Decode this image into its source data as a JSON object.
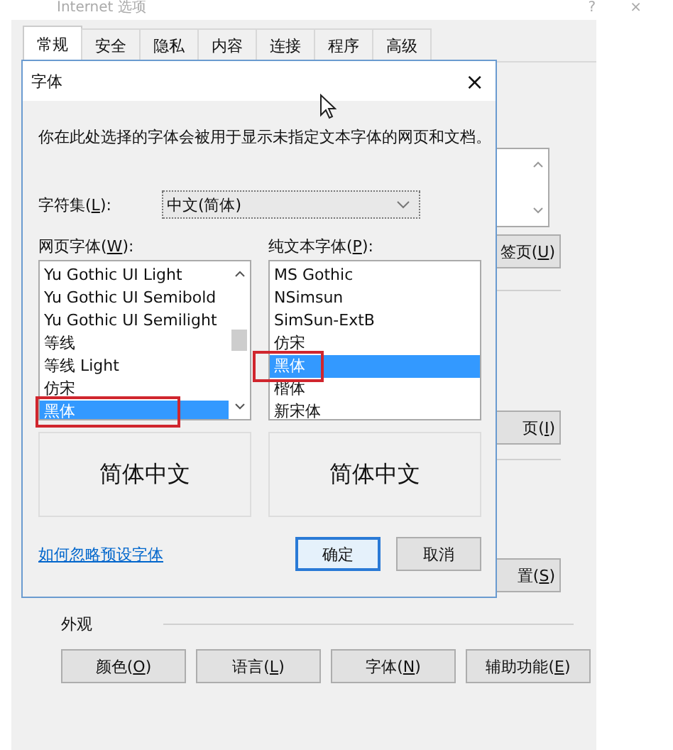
{
  "window": {
    "title": "Internet 选项",
    "help": "?",
    "close": "×"
  },
  "tabs": [
    {
      "label": "常规",
      "selected": true
    },
    {
      "label": "安全",
      "selected": false
    },
    {
      "label": "隐私",
      "selected": false
    },
    {
      "label": "内容",
      "selected": false
    },
    {
      "label": "连接",
      "selected": false
    },
    {
      "label": "程序",
      "selected": false
    },
    {
      "label": "高级",
      "selected": false
    }
  ],
  "background_buttons": [
    {
      "before": "签页(",
      "key": "U",
      "after": ")"
    },
    {
      "before": "页(",
      "key": "I",
      "after": ")"
    },
    {
      "before": "置(",
      "key": "S",
      "after": ")"
    }
  ],
  "appearance": {
    "title": "外观",
    "buttons": [
      {
        "before": "颜色(",
        "key": "O",
        "after": ")"
      },
      {
        "before": "语言(",
        "key": "L",
        "after": ")"
      },
      {
        "before": "字体(",
        "key": "N",
        "after": ")"
      },
      {
        "before": "辅助功能(",
        "key": "E",
        "after": ")"
      }
    ]
  },
  "dialog": {
    "title": "字体",
    "close": "×",
    "description": "你在此处选择的字体会被用于显示未指定文本字体的网页和文档。",
    "charset": {
      "label": {
        "before": "字符集(",
        "key": "L",
        "after": "):"
      },
      "value": "中文(简体)"
    },
    "lists": [
      {
        "label": {
          "before": "网页字体(",
          "key": "W",
          "after": "):"
        },
        "scrollbar": true,
        "preview": "简体中文",
        "items": [
          {
            "name": "Yu Gothic UI Light",
            "selected": false,
            "marked": false
          },
          {
            "name": "Yu Gothic UI Semibold",
            "selected": false,
            "marked": false
          },
          {
            "name": "Yu Gothic UI Semilight",
            "selected": false,
            "marked": false
          },
          {
            "name": "等线",
            "selected": false,
            "marked": false
          },
          {
            "name": "等线 Light",
            "selected": false,
            "marked": false
          },
          {
            "name": "仿宋",
            "selected": false,
            "marked": false
          },
          {
            "name": "黑体",
            "selected": true,
            "marked": true
          }
        ]
      },
      {
        "label": {
          "before": "纯文本字体(",
          "key": "P",
          "after": "):"
        },
        "scrollbar": false,
        "preview": "简体中文",
        "items": [
          {
            "name": "MS Gothic",
            "selected": false,
            "marked": false
          },
          {
            "name": "NSimsun",
            "selected": false,
            "marked": false
          },
          {
            "name": "SimSun-ExtB",
            "selected": false,
            "marked": false
          },
          {
            "name": "仿宋",
            "selected": false,
            "marked": false
          },
          {
            "name": "黑体",
            "selected": true,
            "marked": true
          },
          {
            "name": "楷体",
            "selected": false,
            "marked": false
          },
          {
            "name": "新宋体",
            "selected": false,
            "marked": false
          }
        ]
      }
    ],
    "link": "如何忽略预设字体",
    "buttons": [
      {
        "label": "确定",
        "default": true
      },
      {
        "label": "取消",
        "default": false
      }
    ]
  }
}
